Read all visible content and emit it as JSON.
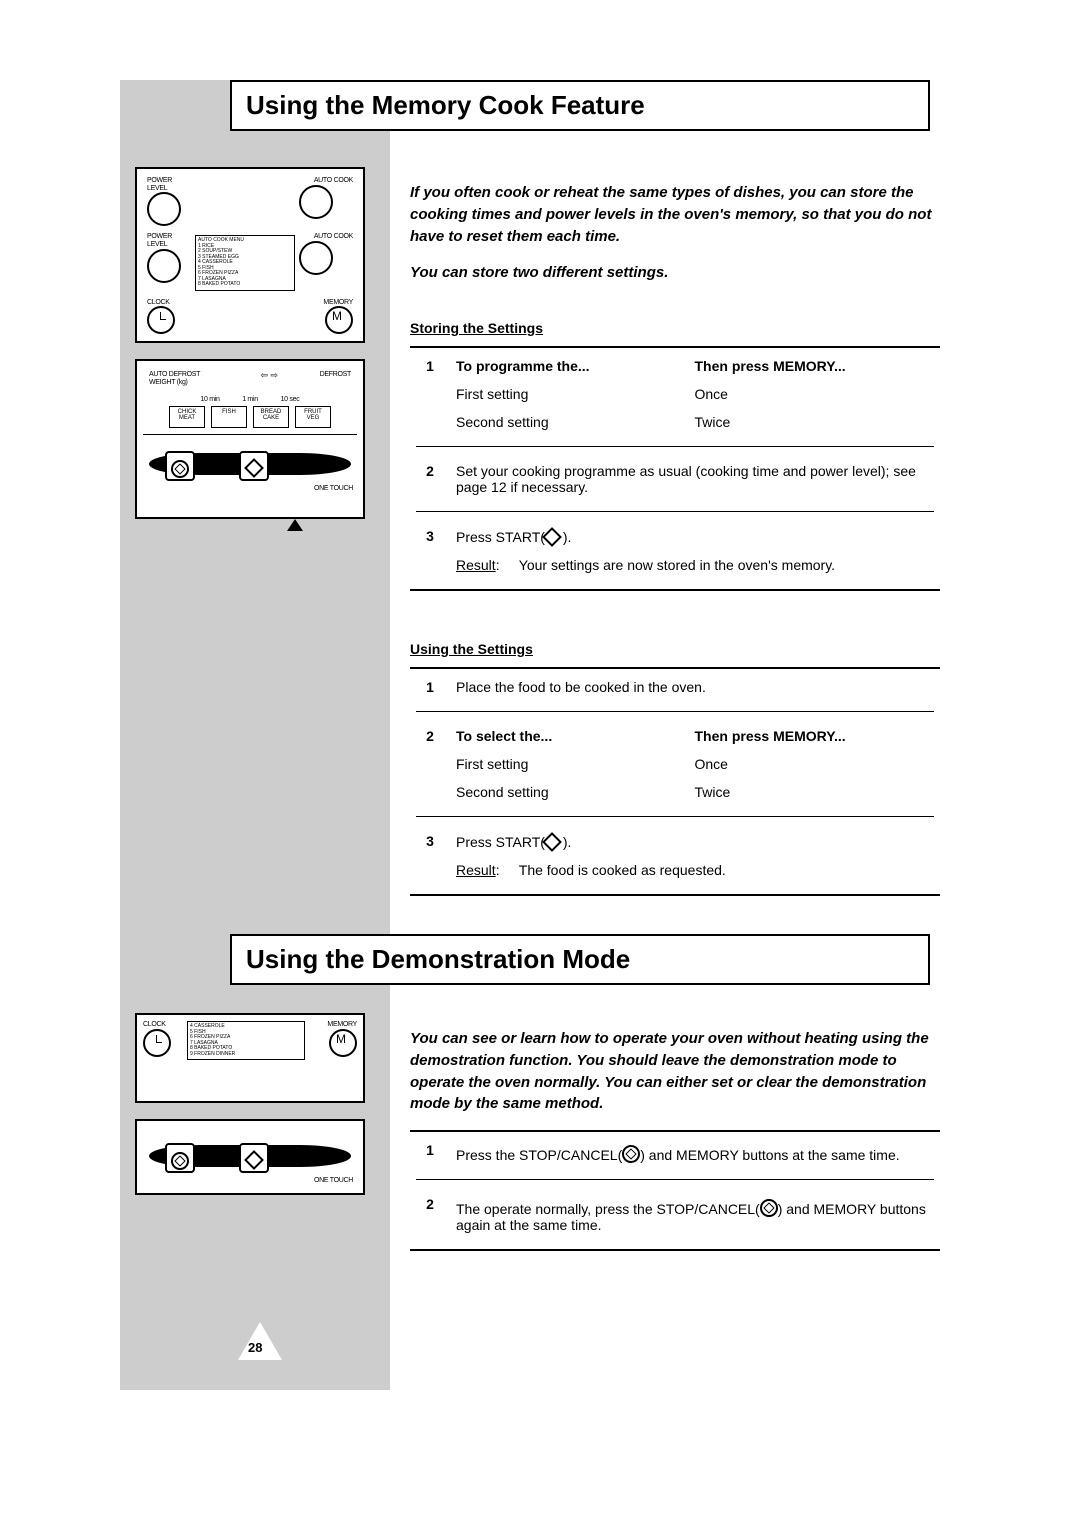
{
  "page_number": "28",
  "section1": {
    "title": "Using the Memory Cook Feature",
    "intro": "If you often cook or reheat the same types of dishes, you can store the cooking times and power levels in the oven's memory, so that you do not have to reset them each time.",
    "intro2": "You can store two different settings.",
    "storing": {
      "heading": "Storing the Settings",
      "row1_a": "To programme the...",
      "row1_b": "Then press MEMORY...",
      "first_a": "First setting",
      "first_b": "Once",
      "second_a": "Second setting",
      "second_b": "Twice",
      "step2": "Set your cooking programme as usual (cooking time and power level); see page 12 if necessary.",
      "step3_pre": "Press START(",
      "step3_post": " ).",
      "result_label": "Result",
      "result_text": "Your settings are now stored in the oven's memory."
    },
    "using": {
      "heading": "Using the Settings",
      "step1": "Place the food to be cooked in the oven.",
      "row2_a": "To select the...",
      "row2_b": "Then press MEMORY...",
      "first_a": "First setting",
      "first_b": "Once",
      "second_a": "Second setting",
      "second_b": "Twice",
      "step3_pre": "Press START(",
      "step3_post": " ).",
      "result_label": "Result",
      "result_text": "The food is cooked as requested."
    }
  },
  "section2": {
    "title": "Using the Demonstration Mode",
    "intro": "You can see or learn how to operate your oven without heating using the demostration function. You should leave the demonstration mode to operate the oven normally. You can either set or clear the demonstration mode by the same method.",
    "step1_pre": "Press the STOP/CANCEL(",
    "step1_post": ") and MEMORY buttons at the same time.",
    "step2_pre": "The operate normally, press the STOP/CANCEL(",
    "step2_post": ") and MEMORY buttons again at the same time."
  }
}
